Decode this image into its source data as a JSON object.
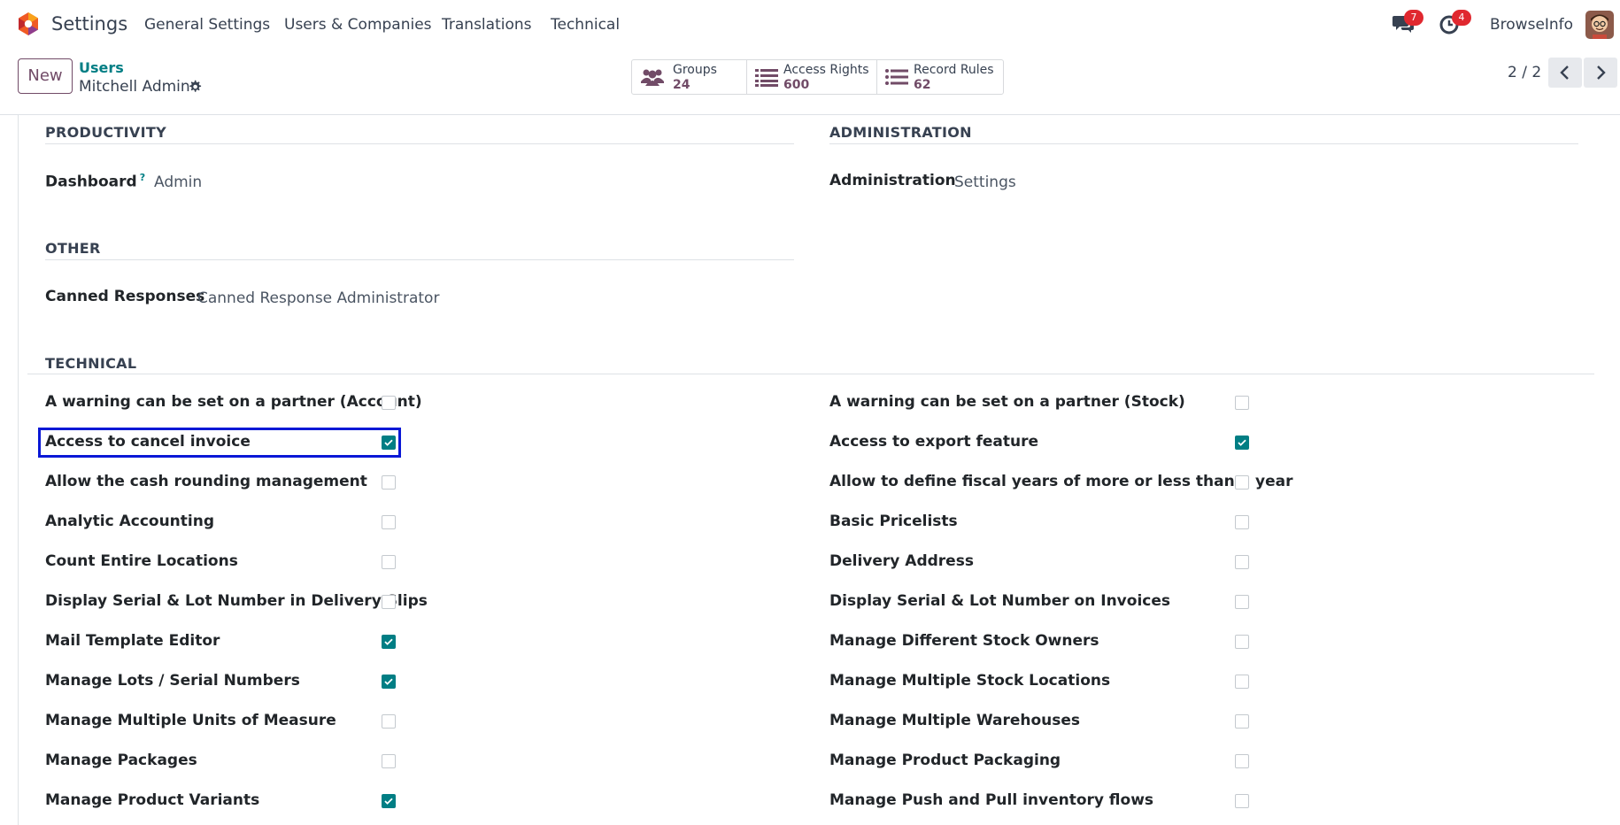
{
  "navbar": {
    "app_name": "Settings",
    "menus": [
      "General Settings",
      "Users & Companies",
      "Translations",
      "Technical"
    ],
    "messages_badge": "7",
    "activities_badge": "4",
    "company": "BrowseInfo"
  },
  "control_panel": {
    "new_button": "New",
    "breadcrumb": "Users",
    "record_title": "Mitchell Admin",
    "smart_buttons": [
      {
        "label": "Groups",
        "value": "24",
        "icon": "users-icon"
      },
      {
        "label": "Access Rights",
        "value": "600",
        "icon": "list-icon"
      },
      {
        "label": "Record Rules",
        "value": "62",
        "icon": "list-icon"
      }
    ],
    "pager": "2 / 2"
  },
  "sections": {
    "productivity": {
      "title": "PRODUCTIVITY",
      "field_label": "Dashboard",
      "help_mark": "?",
      "field_value": "Admin"
    },
    "administration": {
      "title": "ADMINISTRATION",
      "field_label": "Administration",
      "field_value": "Settings"
    },
    "other": {
      "title": "OTHER",
      "field_label": "Canned Responses",
      "field_value": "Canned Response Administrator"
    },
    "technical": {
      "title": "TECHNICAL",
      "left": [
        {
          "label": "A warning can be set on a partner (Account)",
          "checked": false
        },
        {
          "label": "Access to cancel invoice",
          "checked": true
        },
        {
          "label": "Allow the cash rounding management",
          "checked": false
        },
        {
          "label": "Analytic Accounting",
          "checked": false
        },
        {
          "label": "Count Entire Locations",
          "checked": false
        },
        {
          "label": "Display Serial & Lot Number in Delivery Slips",
          "checked": false
        },
        {
          "label": "Mail Template Editor",
          "checked": true
        },
        {
          "label": "Manage Lots / Serial Numbers",
          "checked": true
        },
        {
          "label": "Manage Multiple Units of Measure",
          "checked": false
        },
        {
          "label": "Manage Packages",
          "checked": false
        },
        {
          "label": "Manage Product Variants",
          "checked": true
        }
      ],
      "right": [
        {
          "label": "A warning can be set on a partner (Stock)",
          "checked": false
        },
        {
          "label": "Access to export feature",
          "checked": true
        },
        {
          "label": "Allow to define fiscal years of more or less than a year",
          "checked": false
        },
        {
          "label": "Basic Pricelists",
          "checked": false
        },
        {
          "label": "Delivery Address",
          "checked": false
        },
        {
          "label": "Display Serial & Lot Number on Invoices",
          "checked": false
        },
        {
          "label": "Manage Different Stock Owners",
          "checked": false
        },
        {
          "label": "Manage Multiple Stock Locations",
          "checked": false
        },
        {
          "label": "Manage Multiple Warehouses",
          "checked": false
        },
        {
          "label": "Manage Product Packaging",
          "checked": false
        },
        {
          "label": "Manage Push and Pull inventory flows",
          "checked": false
        }
      ]
    }
  },
  "colors": {
    "accent": "#714b67",
    "teal": "#017e84",
    "highlight": "#0a18d6",
    "badge": "#e0282f"
  }
}
